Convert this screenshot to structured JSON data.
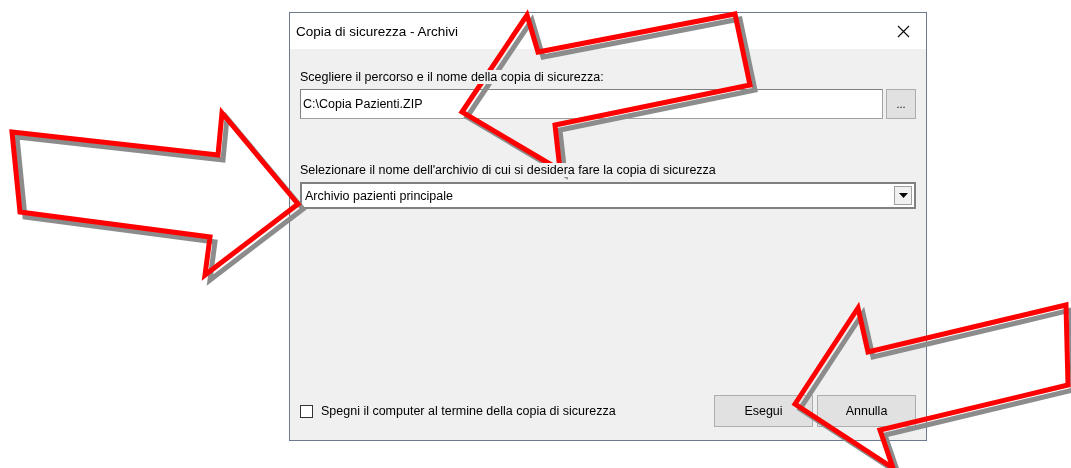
{
  "window": {
    "title": "Copia di sicurezza - Archivi"
  },
  "path": {
    "label": "Scegliere il percorso e il nome della copia di sicurezza:",
    "value": "C:\\Copia Pazienti.ZIP",
    "browse": "..."
  },
  "archive": {
    "label": "Selezionare il nome dell'archivio di cui si desidera fare la copia di sicurezza",
    "value": "Archivio pazienti principale"
  },
  "shutdown": {
    "label": "Spegni il computer al termine della copia di sicurezza",
    "checked": false
  },
  "buttons": [
    {
      "label": "Esegui"
    },
    {
      "label": "Annulla"
    }
  ]
}
